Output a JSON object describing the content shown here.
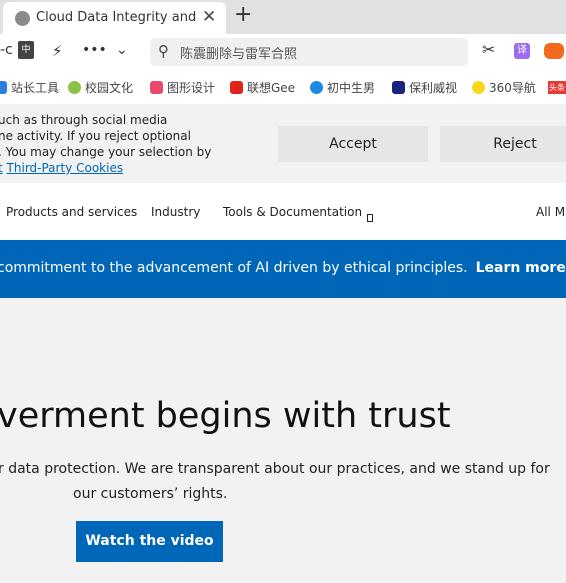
{
  "browser": {
    "tab_title": "Cloud Data Integrity and Co",
    "address_text": "陈震删除与雷军合照",
    "toolbar_fragment": "-c",
    "bookmarks": [
      {
        "label": "站长工具",
        "color": "#2a7de1"
      },
      {
        "label": "校园文化",
        "color": "#8bc34a"
      },
      {
        "label": "图形设计",
        "color": "#e94a6b"
      },
      {
        "label": "联想Gee",
        "color": "#e2231a"
      },
      {
        "label": "初中生男",
        "color": "#1e88e5"
      },
      {
        "label": "保利威视",
        "color": "#1a237e"
      },
      {
        "label": "360导航",
        "color": "#f9d71c"
      },
      {
        "label": "头条",
        "color": "#e53935"
      }
    ]
  },
  "cookie": {
    "lines": [
      "uch as through social media",
      "ne activity. If you reject optional",
      ". You may change your selection by"
    ],
    "link_prefix": "t",
    "link": "Third-Party Cookies",
    "accept": "Accept",
    "reject": "Reject"
  },
  "nav": {
    "items": [
      "Products and services",
      "Industry",
      "Tools & Documentation"
    ],
    "right": "All M"
  },
  "promo": {
    "text": "commitment to the advancement of AI driven by ethical principles.",
    "link": "Learn more"
  },
  "hero": {
    "heading": "verment begins with trust",
    "para1": "r data protection. We are transparent about our practices, and we stand up for",
    "para2": "our customers’ rights.",
    "button": "Watch the video"
  },
  "colors": {
    "brand": "#0067b8"
  }
}
